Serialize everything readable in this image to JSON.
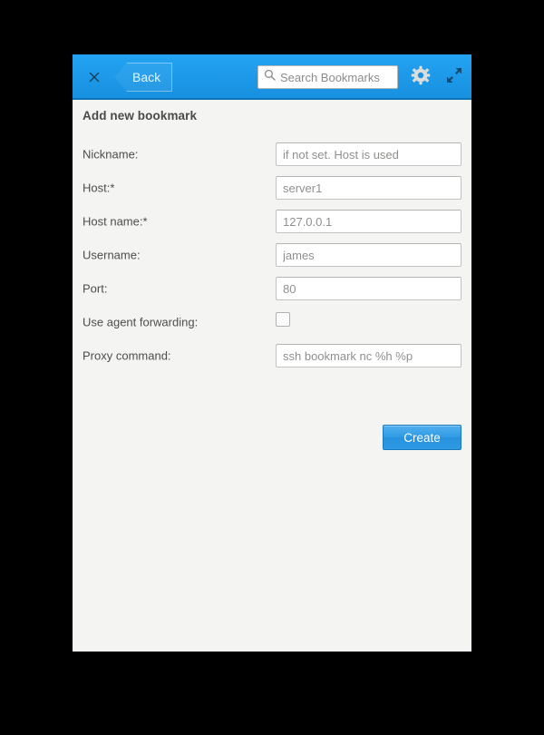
{
  "titlebar": {
    "close_icon": "close-icon",
    "back_label": "Back",
    "search": {
      "icon": "search-icon",
      "value": "",
      "placeholder": "Search Bookmarks"
    },
    "gear_icon": "gear-icon",
    "expand_icon": "expand-icon",
    "background_color": "#1d99e8",
    "border_color": "#0d72b8"
  },
  "content": {
    "title": "Add new bookmark",
    "background_color": "#f4f4f3",
    "fields": [
      {
        "label": "Nickname:",
        "value": "",
        "placeholder": "if not set. Host is used",
        "type": "text"
      },
      {
        "label": "Host:*",
        "value": "",
        "placeholder": "server1",
        "type": "text"
      },
      {
        "label": "Host name:*",
        "value": "",
        "placeholder": "127.0.0.1",
        "type": "text"
      },
      {
        "label": "Username:",
        "value": "",
        "placeholder": "james",
        "type": "text"
      },
      {
        "label": "Port:",
        "value": "",
        "placeholder": "80",
        "type": "text"
      },
      {
        "label": "Use agent forwarding:",
        "value": "",
        "placeholder": "",
        "type": "checkbox",
        "checked": false
      },
      {
        "label": "Proxy command:",
        "value": "",
        "placeholder": "ssh bookmark nc %h %p",
        "type": "text"
      }
    ],
    "create_label": "Create",
    "create_color": "#2f9ae4"
  }
}
